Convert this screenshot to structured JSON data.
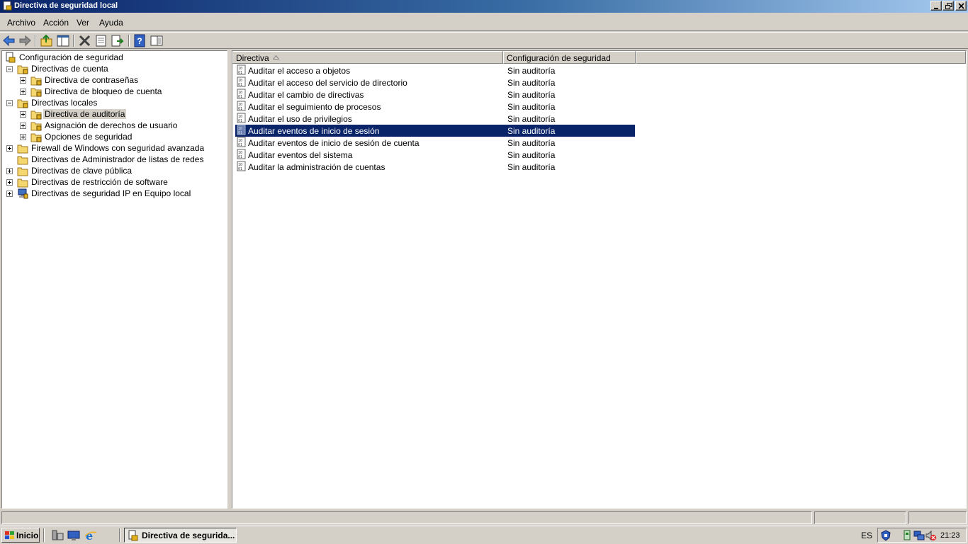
{
  "window": {
    "title": "Directiva de seguridad local"
  },
  "menu": {
    "items": [
      "Archivo",
      "Acción",
      "Ver",
      "Ayuda"
    ]
  },
  "toolbar": {
    "icons": [
      "back-arrow-icon",
      "forward-arrow-icon",
      "up-folder-icon",
      "show-tree-icon",
      "delete-icon",
      "properties-icon",
      "export-list-icon",
      "help-icon",
      "show-hide-icon"
    ]
  },
  "tree": {
    "root": "Configuración de seguridad",
    "items": [
      {
        "label": "Directivas de cuenta"
      },
      {
        "label": "Directiva de contraseñas"
      },
      {
        "label": "Directiva de bloqueo de cuenta"
      },
      {
        "label": "Directivas locales"
      },
      {
        "label": "Directiva de auditoría"
      },
      {
        "label": "Asignación de derechos de usuario"
      },
      {
        "label": "Opciones de seguridad"
      },
      {
        "label": "Firewall de Windows con seguridad avanzada"
      },
      {
        "label": "Directivas de Administrador de listas de redes"
      },
      {
        "label": "Directivas de clave pública"
      },
      {
        "label": "Directivas de restricción de software"
      },
      {
        "label": "Directivas de seguridad IP en Equipo local"
      }
    ]
  },
  "list": {
    "columns": [
      "Directiva",
      "Configuración de seguridad"
    ],
    "rows": [
      {
        "name": "Auditar el acceso a objetos",
        "value": "Sin auditoría"
      },
      {
        "name": "Auditar el acceso del servicio de directorio",
        "value": "Sin auditoría"
      },
      {
        "name": "Auditar el cambio de directivas",
        "value": "Sin auditoría"
      },
      {
        "name": "Auditar el seguimiento de procesos",
        "value": "Sin auditoría"
      },
      {
        "name": "Auditar el uso de privilegios",
        "value": "Sin auditoría"
      },
      {
        "name": "Auditar eventos de inicio de sesión",
        "value": "Sin auditoría"
      },
      {
        "name": "Auditar eventos de inicio de sesión de cuenta",
        "value": "Sin auditoría"
      },
      {
        "name": "Auditar eventos del sistema",
        "value": "Sin auditoría"
      },
      {
        "name": "Auditar la administración de cuentas",
        "value": "Sin auditoría"
      }
    ]
  },
  "taskbar": {
    "start_label": "Inicio",
    "task_label": "Directiva de segurida...",
    "language": "ES",
    "clock": "21:23"
  },
  "colors": {
    "selection": "#0a246a",
    "titlebar_start": "#0a246a",
    "titlebar_end": "#a6caf0"
  }
}
